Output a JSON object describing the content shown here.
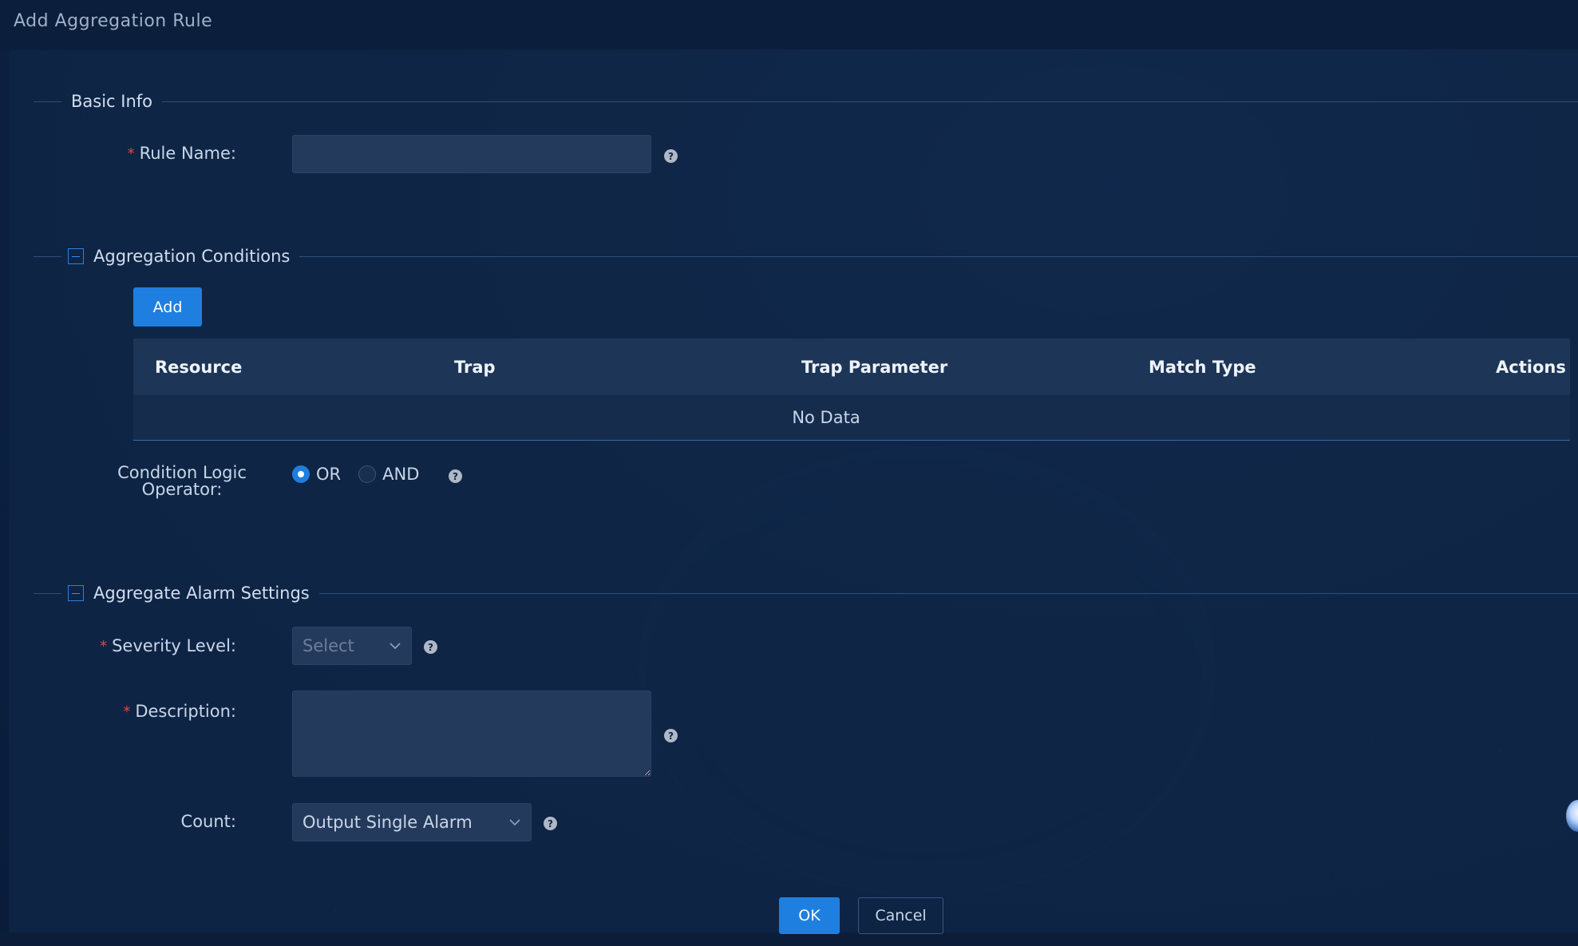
{
  "dialog": {
    "title": "Add Aggregation Rule"
  },
  "basic_info": {
    "section_title": "Basic Info",
    "rule_name": {
      "label": "Rule Name:",
      "value": "",
      "placeholder": ""
    }
  },
  "aggregation_conditions": {
    "section_title": "Aggregation Conditions",
    "add_label": "Add",
    "table": {
      "columns": [
        "Resource",
        "Trap",
        "Trap Parameter",
        "Match Type",
        "Actions"
      ],
      "rows": [],
      "empty_text": "No Data"
    },
    "logic_operator": {
      "label_line1": "Condition Logic",
      "label_line2": "Operator:",
      "options": [
        {
          "label": "OR",
          "checked": true
        },
        {
          "label": "AND",
          "checked": false
        }
      ]
    }
  },
  "aggregate_alarm_settings": {
    "section_title": "Aggregate Alarm Settings",
    "severity": {
      "label": "Severity Level:",
      "placeholder": "Select"
    },
    "description": {
      "label": "Description:",
      "value": "",
      "placeholder": ""
    },
    "count": {
      "label": "Count:",
      "value": "Output Single Alarm"
    }
  },
  "footer": {
    "ok_label": "OK",
    "cancel_label": "Cancel"
  },
  "colors": {
    "primary": "#1f7fe0",
    "required": "#e0483e",
    "panel_bg": "#10264a",
    "input_bg": "#243a5c"
  }
}
